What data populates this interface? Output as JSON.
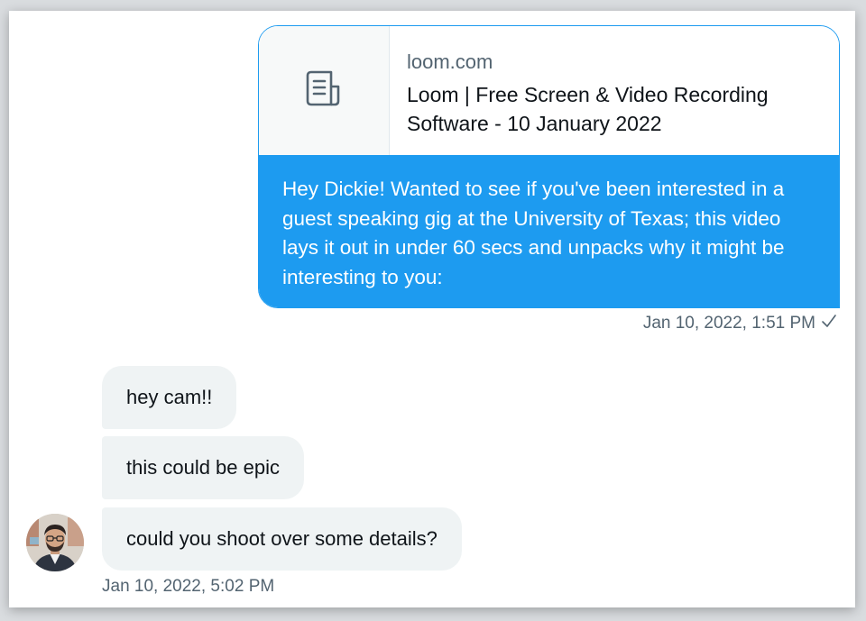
{
  "sent": {
    "link_card": {
      "domain": "loom.com",
      "title": "Loom | Free Screen & Video Recording Software - 10 January 2022",
      "thumbnail_icon": "document-icon"
    },
    "message": "Hey Dickie! Wanted to see if you've been interested in a guest speaking gig at the University of Texas; this video lays it out in under 60 secs and unpacks why it might be interesting to you:",
    "timestamp": "Jan 10, 2022, 1:51 PM",
    "status_icon": "checkmark-icon"
  },
  "received": {
    "messages": [
      "hey cam!!",
      "this could be epic",
      "could you shoot over some details?"
    ],
    "timestamp": "Jan 10, 2022, 5:02 PM",
    "avatar_icon": "avatar"
  },
  "colors": {
    "accent": "#1d9bf0",
    "received_bubble": "#eff3f4",
    "secondary_text": "#536471",
    "primary_text": "#0f1419"
  }
}
